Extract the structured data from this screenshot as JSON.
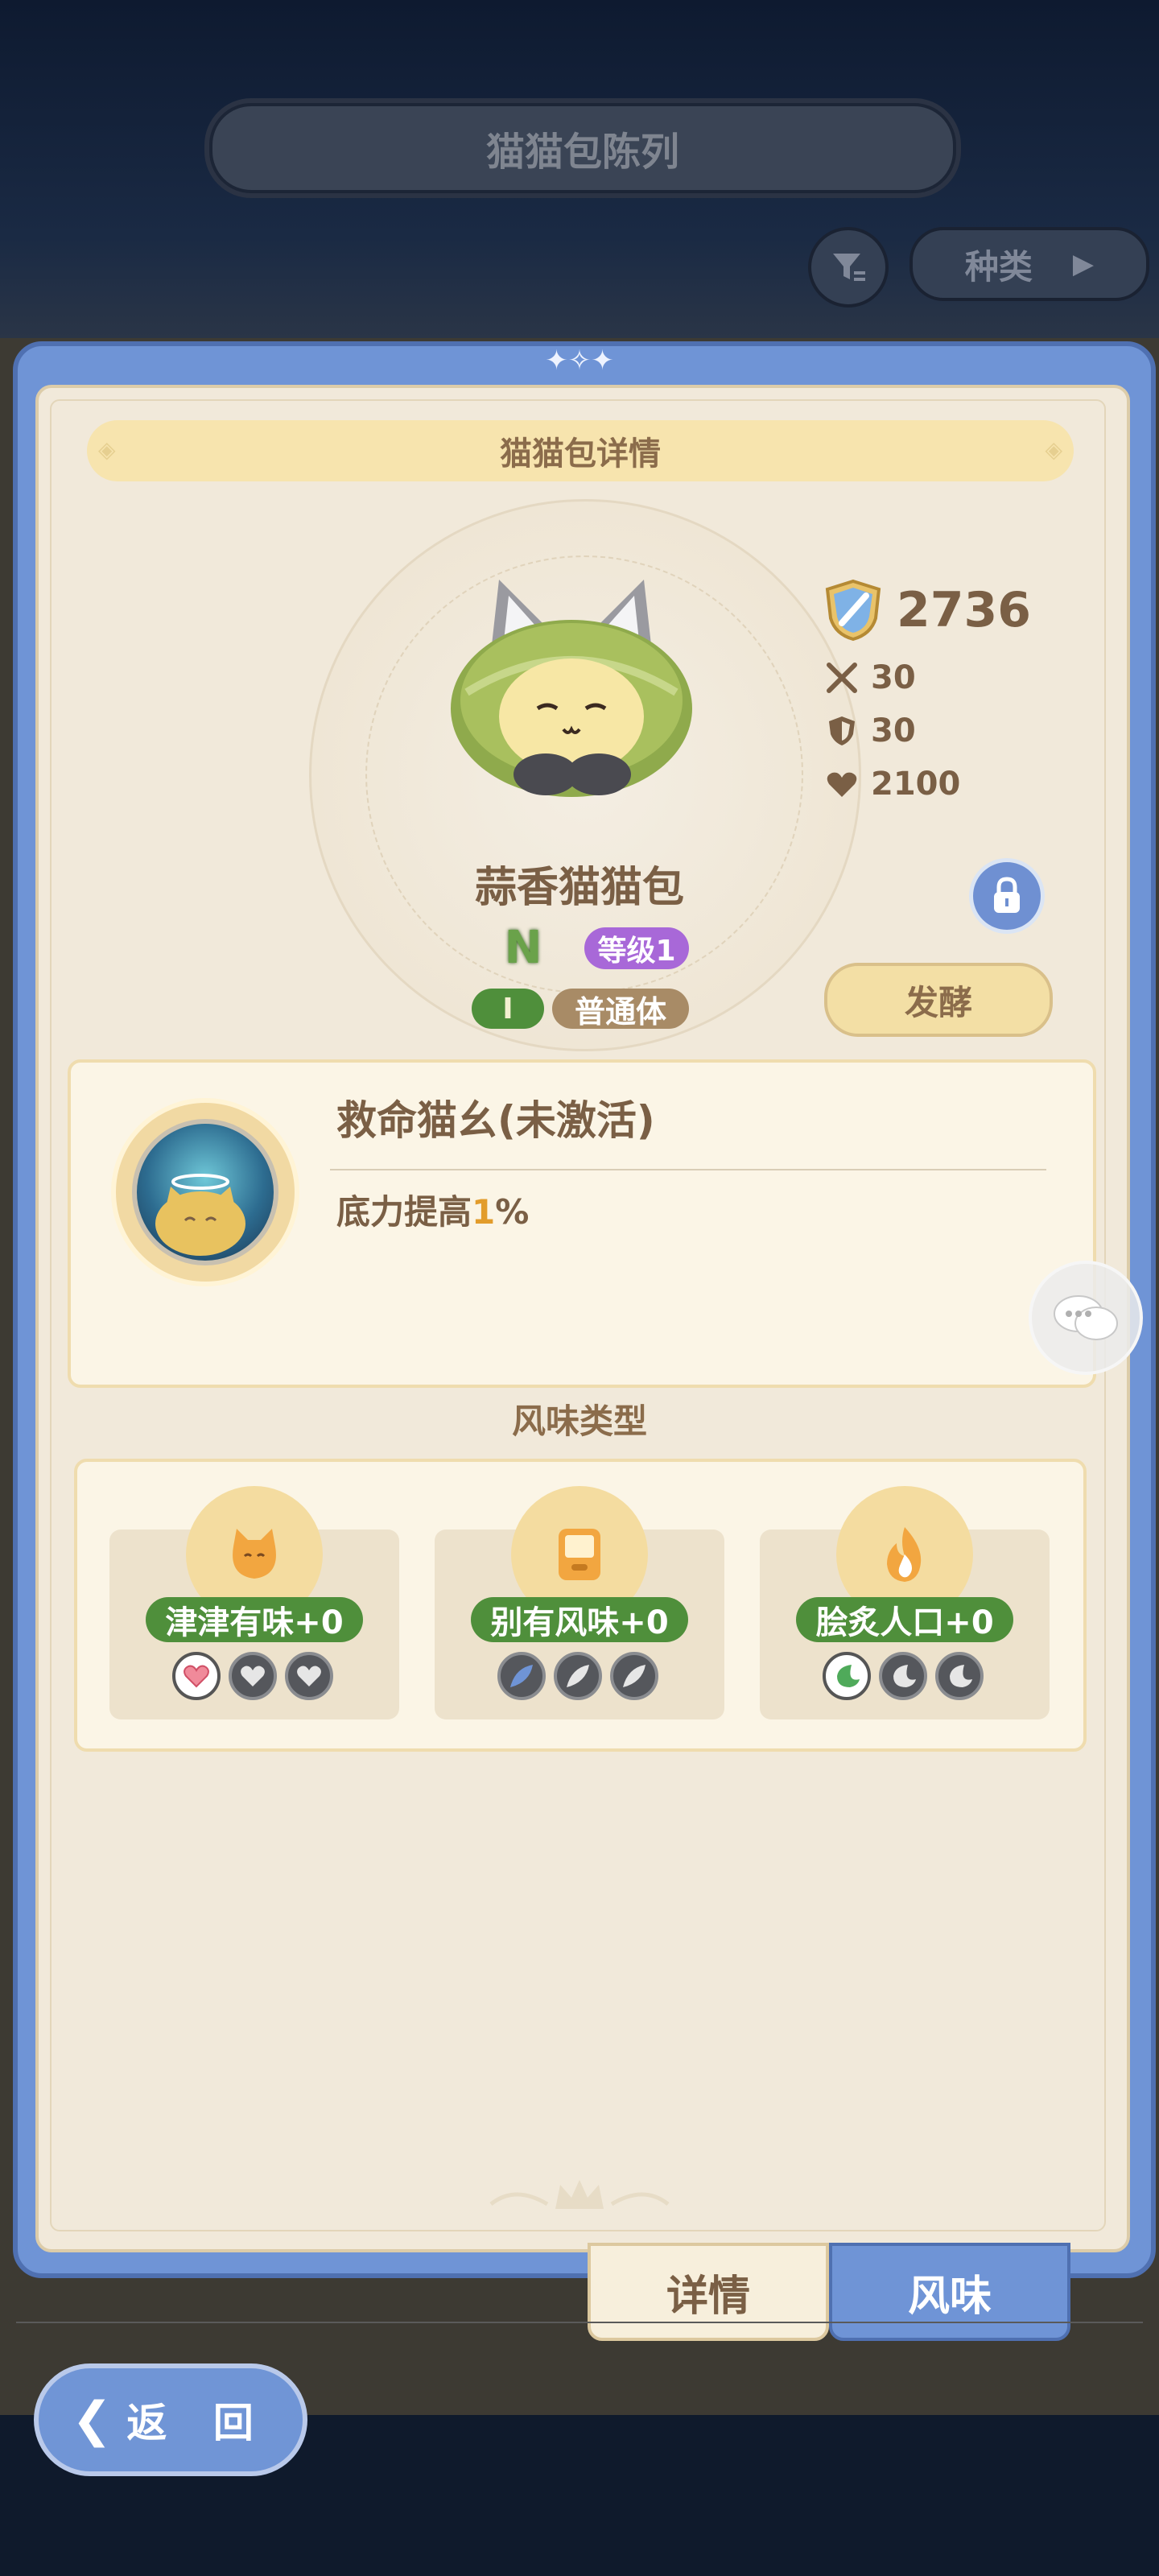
{
  "header": {
    "title": "猫猫包陈列",
    "category_label": "种类"
  },
  "panel": {
    "section_title": "猫猫包详情",
    "character": {
      "name": "蒜香猫猫包",
      "rarity": "N",
      "level_label": "等级1",
      "tier": "I",
      "body_type": "普通体"
    },
    "stats": {
      "power": "2736",
      "attack": "30",
      "defense": "30",
      "hp": "2100"
    },
    "ferment_label": "发酵",
    "skill": {
      "title": "救命猫幺(未激活)",
      "desc_prefix": "底力提高",
      "desc_value": "1",
      "desc_suffix": "%"
    },
    "flavor_section_title": "风味类型",
    "flavors": [
      {
        "label": "津津有味+0",
        "icon": "cat-face-icon",
        "pip_icon": "heart-icon"
      },
      {
        "label": "别有风味+0",
        "icon": "handheld-icon",
        "pip_icon": "feather-icon"
      },
      {
        "label": "脍炙人口+0",
        "icon": "flame-icon",
        "pip_icon": "moon-icon"
      }
    ]
  },
  "tabs": {
    "details": "详情",
    "flavor": "风味"
  },
  "footer": {
    "back_label": "返 回"
  },
  "colors": {
    "accent_blue": "#6f94d6",
    "badge_green": "#4f8f3b",
    "level_purple": "#a868d8",
    "highlight_orange": "#e29c2b"
  }
}
